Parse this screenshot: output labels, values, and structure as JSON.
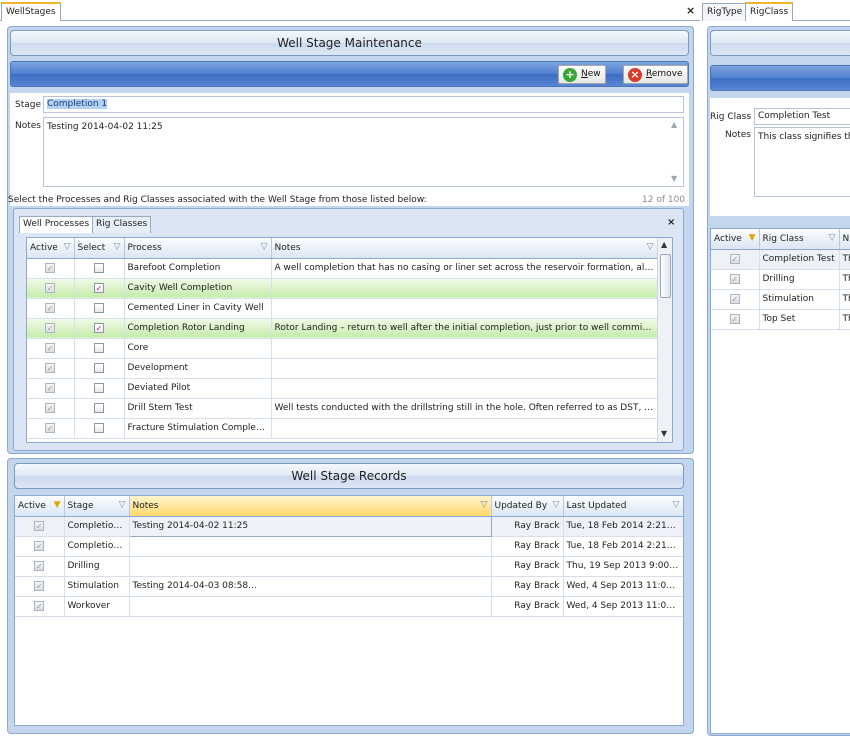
{
  "left_tabs": {
    "active": "WellStages",
    "close": "×"
  },
  "right_tabs": {
    "tab1": "RigType",
    "tab2": "RigClass"
  },
  "well_stage": {
    "title": "Well Stage Maintenance",
    "new_label": "New",
    "new_key": "N",
    "remove_label": "Remove",
    "remove_key": "R",
    "stage_label": "Stage",
    "stage_value": "Completion 1",
    "notes_label": "Notes",
    "notes_value": "Testing 2014-04-02 11:25",
    "instruction": "Select the Processes and Rig Classes associated with the Well Stage from those listed below:",
    "char_count": "12 of 100"
  },
  "sub_tabs": {
    "processes": "Well Processes",
    "rig_classes": "Rig Classes",
    "close": "×"
  },
  "processes_grid": {
    "columns": [
      "Active",
      "Select",
      "Process",
      "Notes"
    ],
    "rows": [
      {
        "active": true,
        "select": false,
        "process": "Barefoot Completion",
        "notes": "A well completion that has no casing or liner set across the reservoir formation, allowi...",
        "hl": false
      },
      {
        "active": true,
        "select": true,
        "process": "Cavity Well Completion",
        "notes": "",
        "hl": true
      },
      {
        "active": true,
        "select": false,
        "process": "Cemented Liner in Cavity Well",
        "notes": "",
        "hl": false
      },
      {
        "active": true,
        "select": true,
        "process": "Completion Rotor Landing",
        "notes": "Rotor Landing – return to well after the initial completion, just prior to well commissio...",
        "hl": true
      },
      {
        "active": true,
        "select": false,
        "process": "Core",
        "notes": "",
        "hl": false
      },
      {
        "active": true,
        "select": false,
        "process": "Development",
        "notes": "",
        "hl": false
      },
      {
        "active": true,
        "select": false,
        "process": "Deviated Pilot",
        "notes": "",
        "hl": false
      },
      {
        "active": true,
        "select": false,
        "process": "Drill Stem Test",
        "notes": "Well tests conducted with the drillstring still in the hole. Often referred to as DST, thes...",
        "hl": false
      },
      {
        "active": true,
        "select": false,
        "process": "Fracture Stimulation Completion",
        "notes": "",
        "hl": false
      }
    ]
  },
  "records": {
    "title": "Well Stage Records",
    "columns": [
      "Active",
      "Stage",
      "Notes",
      "Updated By",
      "Last Updated"
    ],
    "rows": [
      {
        "active": true,
        "stage": "Completion 1",
        "notes": "Testing 2014-04-02 11:25",
        "updated_by": "Ray Brack",
        "last_updated": "Tue, 18 Feb 2014 2:21pm"
      },
      {
        "active": true,
        "stage": "Completion 2",
        "notes": "",
        "updated_by": "Ray Brack",
        "last_updated": "Tue, 18 Feb 2014 2:21pm"
      },
      {
        "active": true,
        "stage": "Drilling",
        "notes": "",
        "updated_by": "Ray Brack",
        "last_updated": "Thu, 19 Sep 2013 9:00am"
      },
      {
        "active": true,
        "stage": "Stimulation",
        "notes": "Testing 2014-04-03 08:58...",
        "updated_by": "Ray Brack",
        "last_updated": "Wed, 4 Sep 2013 11:05am"
      },
      {
        "active": true,
        "stage": "Workover",
        "notes": "",
        "updated_by": "Ray Brack",
        "last_updated": "Wed, 4 Sep 2013 11:05am"
      }
    ]
  },
  "rig_class": {
    "rig_class_label": "Rig Class",
    "rig_class_value": "Completion Test",
    "notes_label": "Notes",
    "notes_value": "This class signifies th",
    "columns": [
      "Active",
      "Rig Class",
      "N"
    ],
    "rows": [
      {
        "active": true,
        "name": "Completion Test",
        "notes": "Th"
      },
      {
        "active": true,
        "name": "Drilling",
        "notes": "Th"
      },
      {
        "active": true,
        "name": "Stimulation",
        "notes": "Th"
      },
      {
        "active": true,
        "name": "Top Set",
        "notes": "Th"
      }
    ]
  },
  "icons": {
    "filter": "funnel-icon",
    "new": "plus-circle-icon",
    "remove": "x-circle-icon"
  },
  "colors": {
    "selected_row": "#c5ebaa",
    "header_bar": "#4f7fd0",
    "active_filter": "#e0a800"
  }
}
